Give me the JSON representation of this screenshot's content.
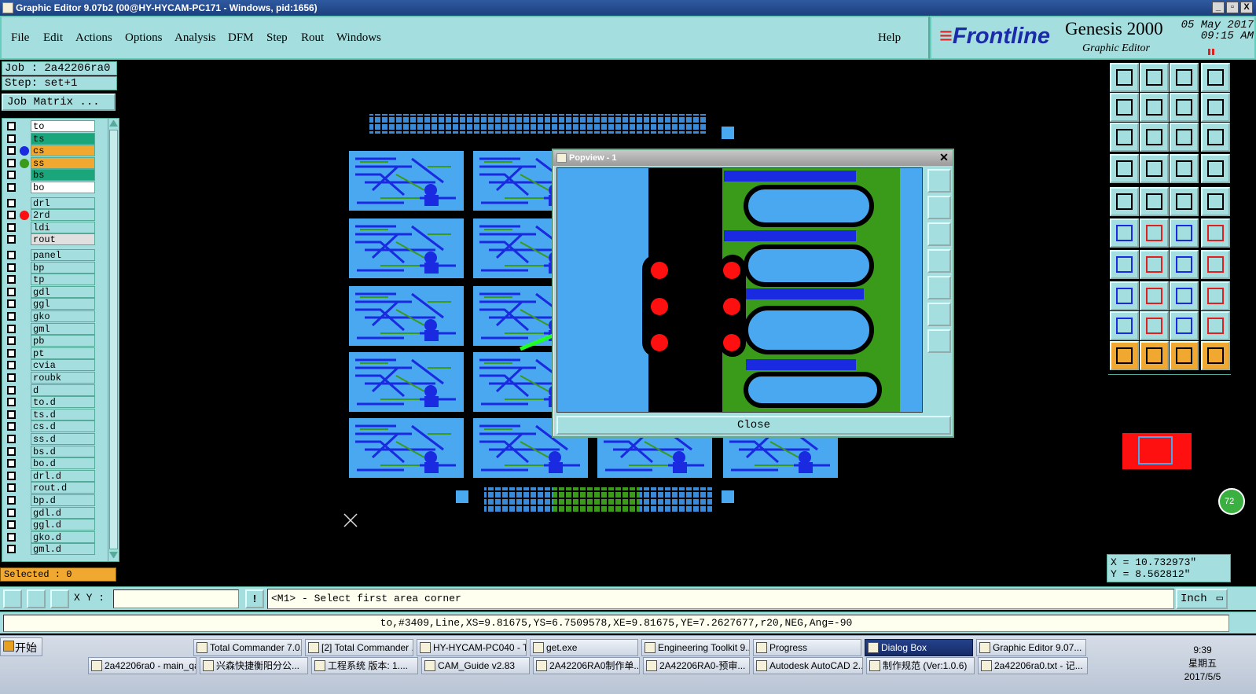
{
  "window": {
    "title": "Graphic Editor 9.07b2 (00@HY-HYCAM-PC171 - Windows, pid:1656)",
    "btn_min": "_",
    "btn_max": "▫",
    "btn_close": "X"
  },
  "menu": {
    "items": [
      "File",
      "Edit",
      "Actions",
      "Options",
      "Analysis",
      "DFM",
      "Step",
      "Rout",
      "Windows"
    ],
    "help": "Help"
  },
  "brand": {
    "logo_main": "Frontline",
    "product": "Genesis 2000",
    "subtitle": "Graphic Editor",
    "date": "05 May 2017",
    "time": "09:15 AM"
  },
  "job": {
    "job_label": "Job : 2a42206ra0",
    "step_label": "Step: set+1",
    "matrix_button": "Job Matrix ..."
  },
  "layers": [
    {
      "name": "to",
      "color": "#ffffff",
      "dot": ""
    },
    {
      "name": "ts",
      "color": "#1aa57a",
      "dot": ""
    },
    {
      "name": "cs",
      "color": "#f0a830",
      "dot": "#1a2ae0"
    },
    {
      "name": "ss",
      "color": "#f0a830",
      "dot": "#3a9a1a"
    },
    {
      "name": "bs",
      "color": "#1aa57a",
      "dot": ""
    },
    {
      "name": "bo",
      "color": "#ffffff",
      "dot": ""
    },
    {
      "name": "drl",
      "color": "#a5dede",
      "dot": ""
    },
    {
      "name": "2rd",
      "color": "#a5dede",
      "dot": "#ff1010"
    },
    {
      "name": "ldi",
      "color": "#a5dede",
      "dot": ""
    },
    {
      "name": "rout",
      "color": "#e0e0e0",
      "dot": ""
    },
    {
      "name": "panel",
      "color": "#a5dede",
      "dot": ""
    },
    {
      "name": "bp",
      "color": "#a5dede",
      "dot": ""
    },
    {
      "name": "tp",
      "color": "#a5dede",
      "dot": ""
    },
    {
      "name": "gdl",
      "color": "#a5dede",
      "dot": ""
    },
    {
      "name": "ggl",
      "color": "#a5dede",
      "dot": ""
    },
    {
      "name": "gko",
      "color": "#a5dede",
      "dot": ""
    },
    {
      "name": "gml",
      "color": "#a5dede",
      "dot": ""
    },
    {
      "name": "pb",
      "color": "#a5dede",
      "dot": ""
    },
    {
      "name": "pt",
      "color": "#a5dede",
      "dot": ""
    },
    {
      "name": "cvia",
      "color": "#a5dede",
      "dot": ""
    },
    {
      "name": "roubk",
      "color": "#a5dede",
      "dot": ""
    },
    {
      "name": "d",
      "color": "#a5dede",
      "dot": ""
    },
    {
      "name": "to.d",
      "color": "#a5dede",
      "dot": ""
    },
    {
      "name": "ts.d",
      "color": "#a5dede",
      "dot": ""
    },
    {
      "name": "cs.d",
      "color": "#a5dede",
      "dot": ""
    },
    {
      "name": "ss.d",
      "color": "#a5dede",
      "dot": ""
    },
    {
      "name": "bs.d",
      "color": "#a5dede",
      "dot": ""
    },
    {
      "name": "bo.d",
      "color": "#a5dede",
      "dot": ""
    },
    {
      "name": "drl.d",
      "color": "#a5dede",
      "dot": ""
    },
    {
      "name": "rout.d",
      "color": "#a5dede",
      "dot": ""
    },
    {
      "name": "bp.d",
      "color": "#a5dede",
      "dot": ""
    },
    {
      "name": "gdl.d",
      "color": "#a5dede",
      "dot": ""
    },
    {
      "name": "ggl.d",
      "color": "#a5dede",
      "dot": ""
    },
    {
      "name": "gko.d",
      "color": "#a5dede",
      "dot": ""
    },
    {
      "name": "gml.d",
      "color": "#a5dede",
      "dot": ""
    }
  ],
  "selected": "Selected : 0",
  "popview": {
    "title": "Popview - 1",
    "close_button": "Close"
  },
  "coords": {
    "x": "X = 10.732973\"",
    "y": "Y = 8.562812\""
  },
  "cmdbar": {
    "xy_label": "X Y :",
    "xy_value": "",
    "prompt": "<M1> - Select first area corner",
    "units": "Inch"
  },
  "status": "to,#3409,Line,XS=9.81675,YS=6.7509578,XE=9.81675,YE=7.2627677,r20,NEG,Ang=-90",
  "taskbar": {
    "start": "开始",
    "row1": [
      "Total Commander 7.0...",
      "[2] Total Commander ...",
      "HY-HYCAM-PC040 - T...",
      "get.exe",
      "Engineering Toolkit 9....",
      "Progress",
      "Dialog Box",
      "Graphic Editor 9.07..."
    ],
    "row2": [
      "2a42206ra0 - main_qa",
      "兴森快捷衡阳分公...",
      "工程系统 版本: 1....",
      "CAM_Guide v2.83",
      "2A42206RA0制作单...",
      "2A42206RA0-预审...",
      "Autodesk AutoCAD 2...",
      "制作规范 (Ver:1.0.6)",
      "2a42206ra0.txt - 记..."
    ],
    "clock_time": "9:39",
    "clock_day": "星期五",
    "clock_date": "2017/5/5",
    "badge": "72"
  },
  "colors": {
    "panel": "#a5dede",
    "accent": "#f0a830",
    "board_blue": "#4aa8f0",
    "copper_green": "#3a9a1a",
    "pad_red": "#ff1010"
  }
}
